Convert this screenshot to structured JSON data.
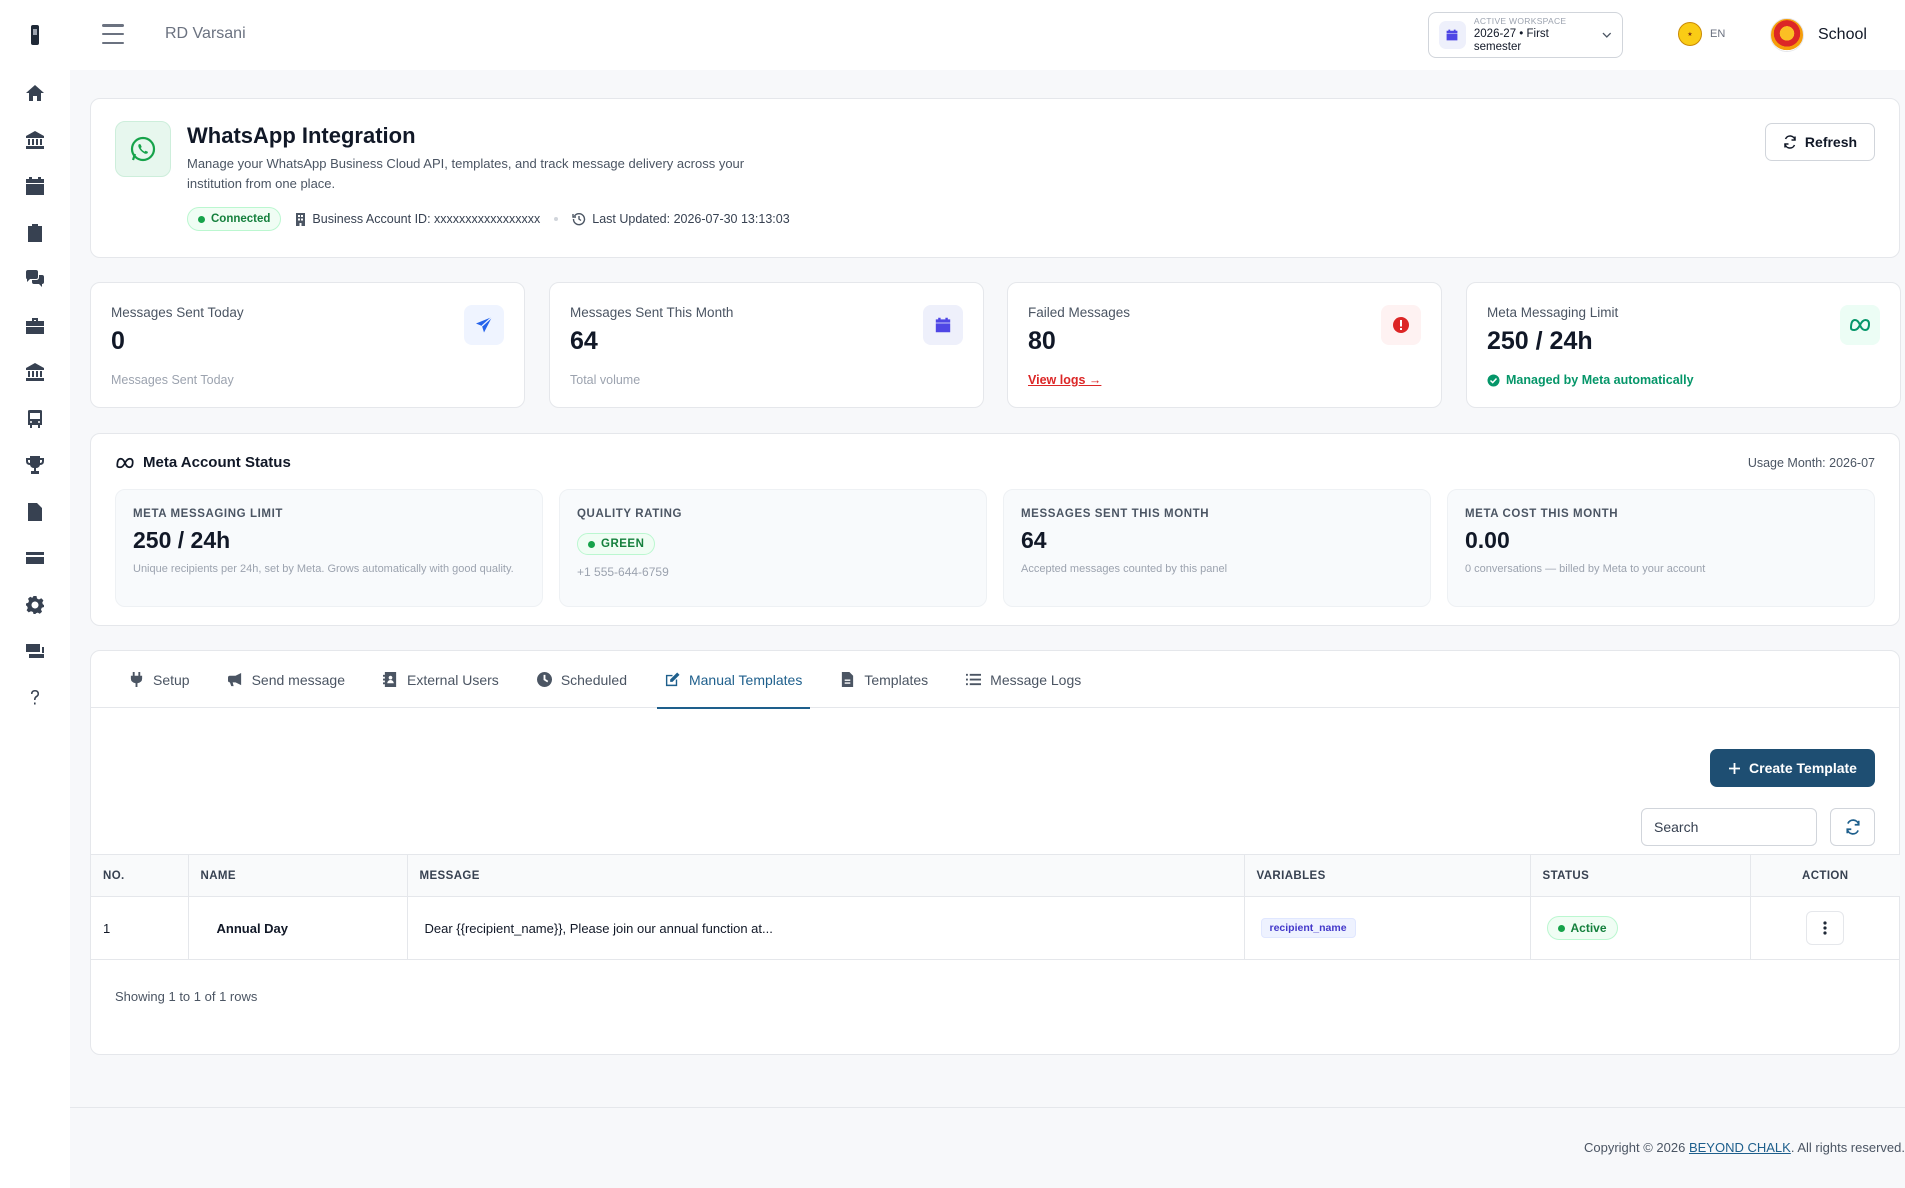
{
  "topbar": {
    "org_name": "RD Varsani",
    "workspace_label": "ACTIVE WORKSPACE",
    "workspace_value": "2026-27 • First semester",
    "lang": "EN",
    "user_name": "School"
  },
  "sidebar": {
    "items": [
      {
        "icon": "home-icon"
      },
      {
        "icon": "institution-icon"
      },
      {
        "icon": "calendar-icon"
      },
      {
        "icon": "clipboard-icon"
      },
      {
        "icon": "chat-icon"
      },
      {
        "icon": "briefcase-icon"
      },
      {
        "icon": "bank-icon"
      },
      {
        "icon": "bus-icon"
      },
      {
        "icon": "trophy-icon"
      },
      {
        "icon": "document-icon"
      },
      {
        "icon": "card-icon"
      },
      {
        "icon": "gear-icon"
      },
      {
        "icon": "money-icon"
      },
      {
        "icon": "help-icon"
      }
    ]
  },
  "header": {
    "title": "WhatsApp Integration",
    "description": "Manage your WhatsApp Business Cloud API, templates, and track message delivery across your institution from one place.",
    "status": "Connected",
    "business_account": "Business Account ID: xxxxxxxxxxxxxxxxx",
    "last_updated": "Last Updated: 2026-07-30 13:13:03",
    "refresh_label": "Refresh"
  },
  "stats": [
    {
      "title": "Messages Sent Today",
      "value": "0",
      "foot": "Messages Sent Today",
      "icon": "send-icon",
      "color": "#2563eb"
    },
    {
      "title": "Messages Sent This Month",
      "value": "64",
      "foot": "Total volume",
      "icon": "calendar-icon",
      "color": "#4f46e5"
    },
    {
      "title": "Failed Messages",
      "value": "80",
      "foot": "View logs →",
      "icon": "alert-icon",
      "color": "#dc2626"
    },
    {
      "title": "Meta Messaging Limit",
      "value": "250 / 24h",
      "foot": "Managed by Meta automatically",
      "icon": "meta-icon",
      "color": "#059669"
    }
  ],
  "meta_status": {
    "title": "Meta Account Status",
    "usage_month": "Usage Month: 2026-07",
    "boxes": [
      {
        "label": "META MESSAGING LIMIT",
        "value": "250 / 24h",
        "desc": "Unique recipients per 24h, set by Meta. Grows automatically with good quality."
      },
      {
        "label": "QUALITY RATING",
        "badge": "GREEN",
        "phone": "+1 555-644-6759"
      },
      {
        "label": "MESSAGES SENT THIS MONTH",
        "value": "64",
        "desc": "Accepted messages counted by this panel"
      },
      {
        "label": "META COST THIS MONTH",
        "value": "0.00",
        "desc": "0 conversations — billed by Meta to your account"
      }
    ]
  },
  "tabs": [
    {
      "label": "Setup",
      "icon": "plug-icon"
    },
    {
      "label": "Send message",
      "icon": "megaphone-icon"
    },
    {
      "label": "External Users",
      "icon": "contact-icon"
    },
    {
      "label": "Scheduled",
      "icon": "clock-icon"
    },
    {
      "label": "Manual Templates",
      "icon": "edit-icon",
      "active": true
    },
    {
      "label": "Templates",
      "icon": "file-icon"
    },
    {
      "label": "Message Logs",
      "icon": "list-icon"
    }
  ],
  "templates": {
    "create_label": "Create Template",
    "search_placeholder": "Search",
    "columns": [
      "NO.",
      "NAME",
      "MESSAGE",
      "VARIABLES",
      "STATUS",
      "ACTION"
    ],
    "rows": [
      {
        "no": "1",
        "name": "Annual Day",
        "message": "Dear {{recipient_name}}, Please join our annual function at...",
        "variables": "recipient_name",
        "status": "Active"
      }
    ],
    "showing": "Showing 1 to 1 of 1 rows"
  },
  "footer": {
    "prefix": "Copyright © 2026 ",
    "link": "BEYOND CHALK",
    "suffix": ". All rights reserved."
  }
}
